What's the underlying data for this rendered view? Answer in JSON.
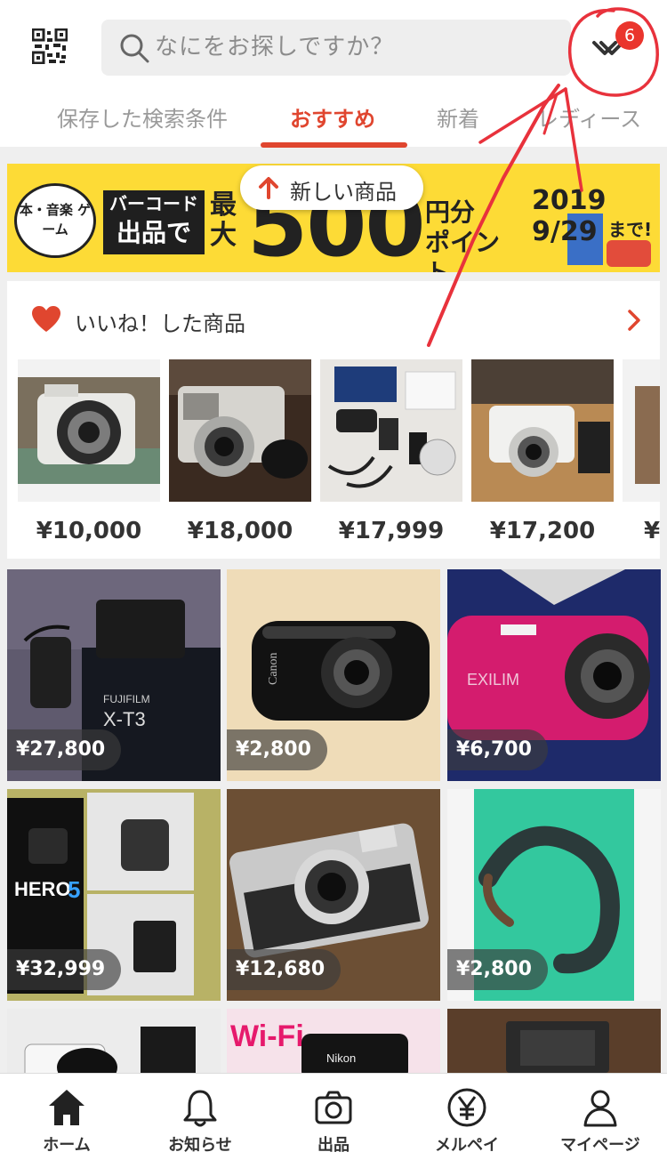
{
  "header": {
    "search_placeholder": "なにをお探しですか？",
    "todo_badge": "6"
  },
  "tabs": [
    {
      "label": "保存した検索条件"
    },
    {
      "label": "おすすめ"
    },
    {
      "label": "新着"
    },
    {
      "label": "レディース"
    }
  ],
  "banner": {
    "bubble": "本・音楽 ゲーム",
    "barcode_line1": "バーコード",
    "barcode_line2": "出品で",
    "max": "最大",
    "amount": "500",
    "unit": "円分 ポイント",
    "date": "2019 9/29",
    "until": "まで!"
  },
  "new_items_pill": "新しい商品",
  "liked": {
    "title": "いいね！した商品",
    "prices": [
      "¥10,000",
      "¥18,000",
      "¥17,999",
      "¥17,200",
      "¥"
    ]
  },
  "grid": {
    "prices": [
      "¥27,800",
      "¥2,800",
      "¥6,700",
      "¥32,999",
      "¥12,680",
      "¥2,800"
    ]
  },
  "bottom_nav": [
    {
      "label": "ホーム",
      "icon": "home-icon"
    },
    {
      "label": "お知らせ",
      "icon": "bell-icon"
    },
    {
      "label": "出品",
      "icon": "camera-icon"
    },
    {
      "label": "メルペイ",
      "icon": "yen-icon"
    },
    {
      "label": "マイページ",
      "icon": "person-icon"
    }
  ],
  "colors": {
    "accent": "#e0462f",
    "badge": "#ea352d",
    "banner_bg": "#fddb36",
    "annotation": "#e8323c"
  }
}
